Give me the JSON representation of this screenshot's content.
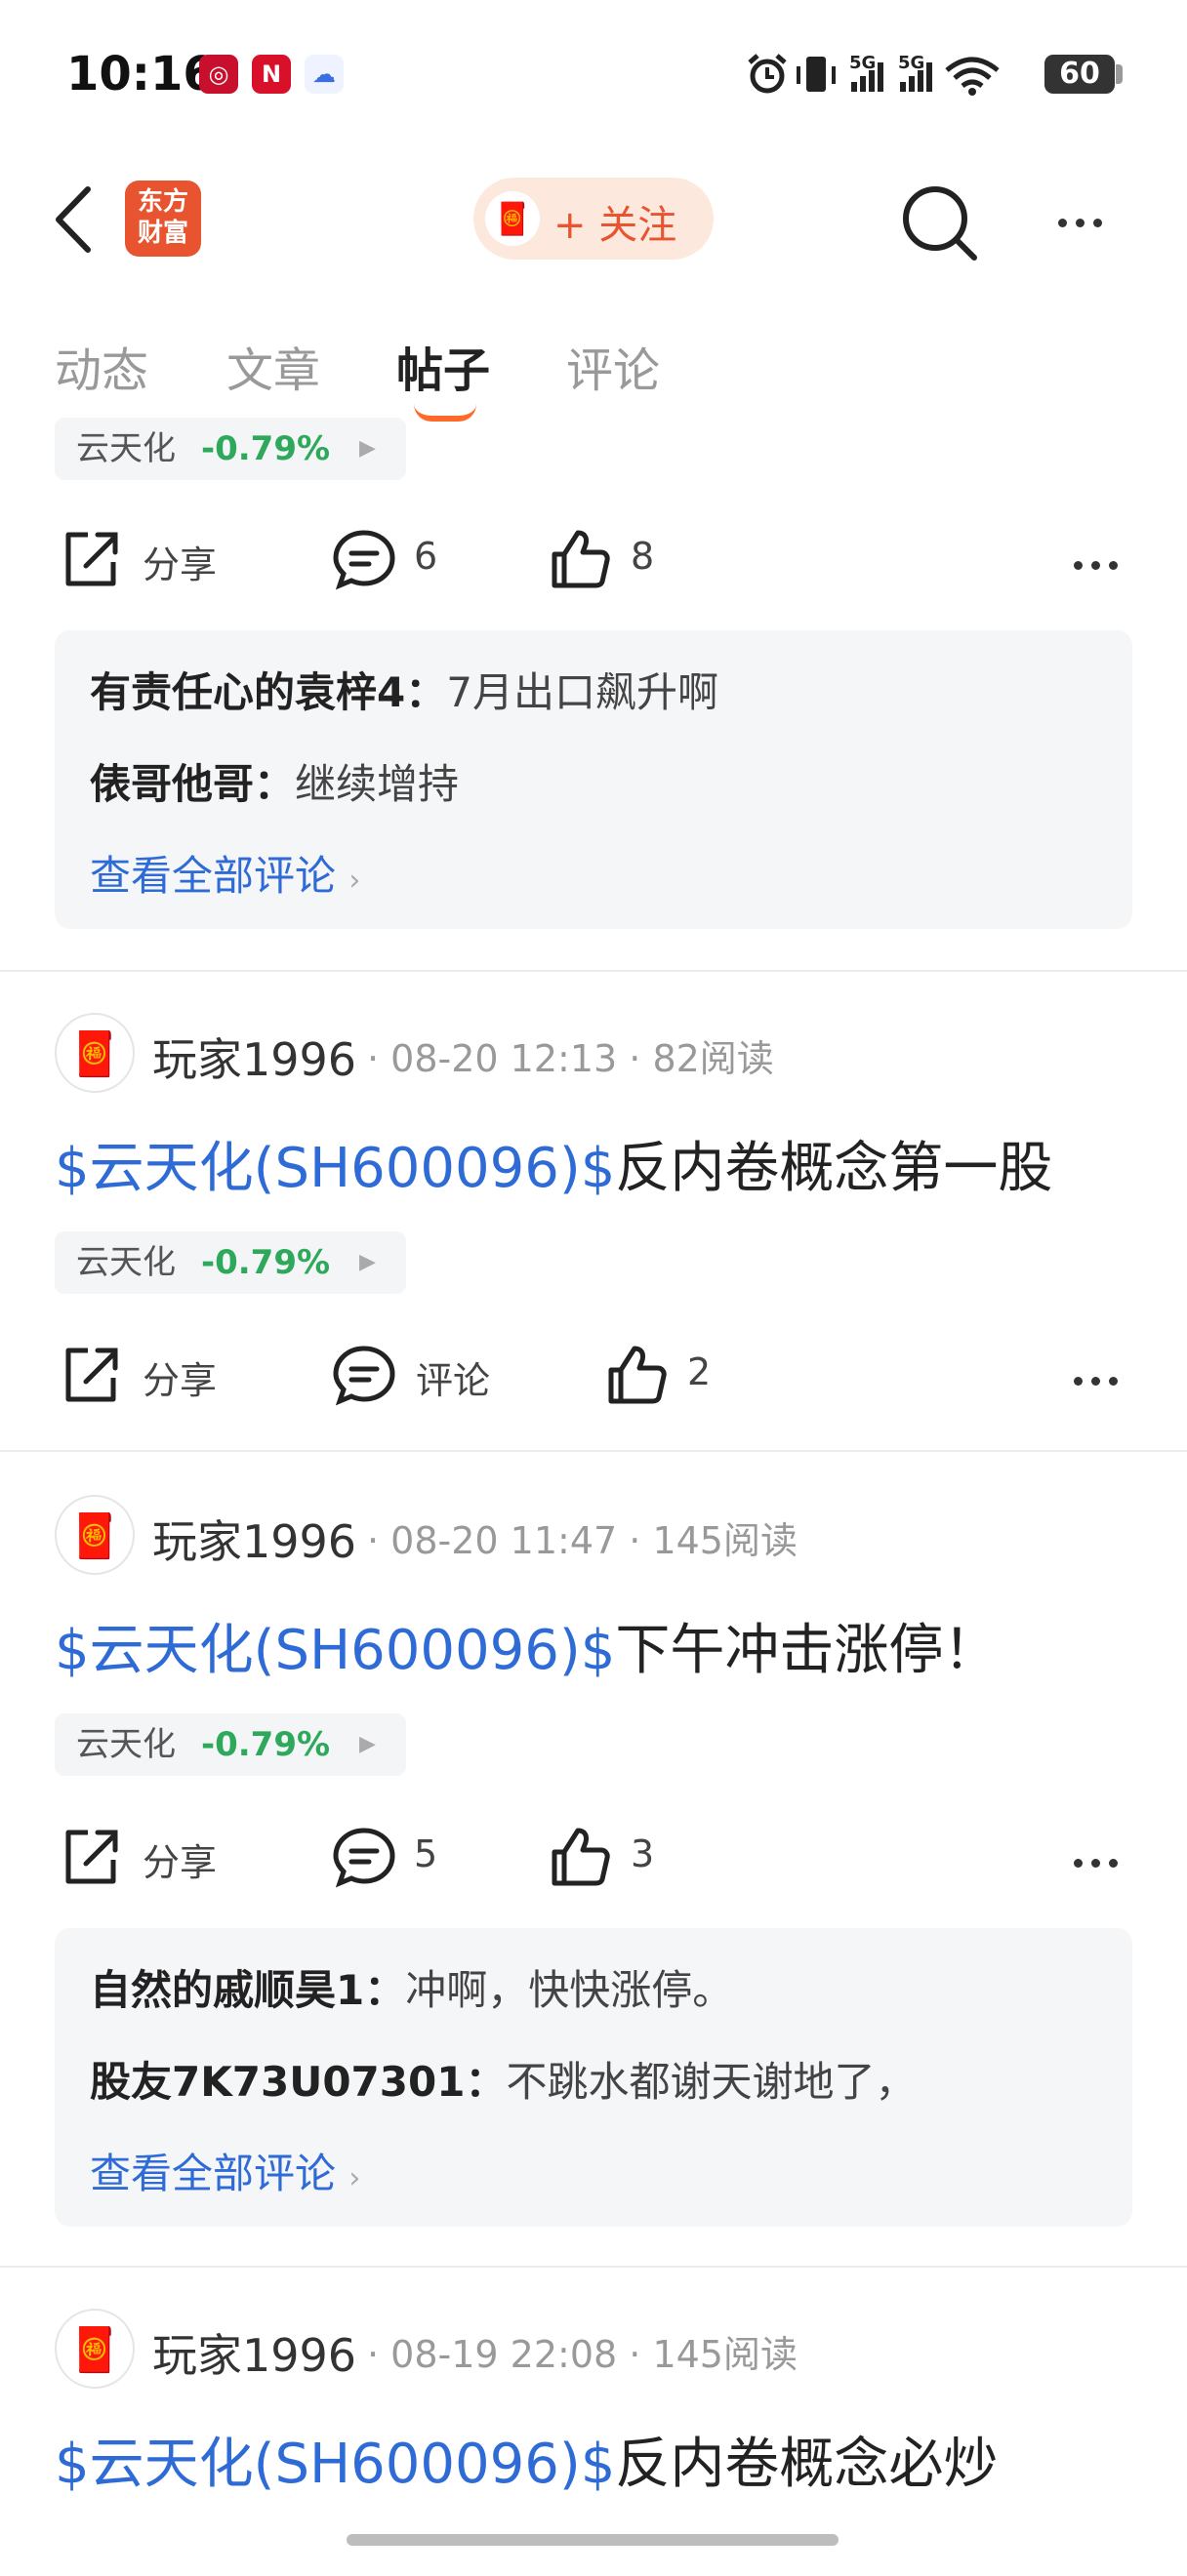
{
  "status_bar": {
    "time": "10:16",
    "battery": "60",
    "network": "5G"
  },
  "header": {
    "logo_text": "东方财富",
    "follow_label": "+ 关注"
  },
  "tabs": [
    {
      "label": "动态"
    },
    {
      "label": "文章"
    },
    {
      "label": "帖子",
      "active": true
    },
    {
      "label": "评论"
    }
  ],
  "post0": {
    "stock": {
      "name": "云天化",
      "change": "-0.79%"
    },
    "share_label": "分享",
    "comment_count": "6",
    "like_count": "8",
    "comments": [
      {
        "user": "有责任心的袁梓4：",
        "text": "7月出口飙升啊"
      },
      {
        "user": "俵哥他哥：",
        "text": "继续增持"
      }
    ],
    "view_all": "查看全部评论"
  },
  "post1": {
    "user": "玩家1996",
    "time": "08-20 12:13",
    "reads": "82阅读",
    "tag": "$云天化(SH600096)$",
    "title_text": "反内卷概念第一股",
    "stock": {
      "name": "云天化",
      "change": "-0.79%"
    },
    "share_label": "分享",
    "comment_label": "评论",
    "like_count": "2"
  },
  "post2": {
    "user": "玩家1996",
    "time": "08-20 11:47",
    "reads": "145阅读",
    "tag": "$云天化(SH600096)$",
    "title_text": "下午冲击涨停！",
    "stock": {
      "name": "云天化",
      "change": "-0.79%"
    },
    "share_label": "分享",
    "comment_count": "5",
    "like_count": "3",
    "comments": [
      {
        "user": "自然的戚顺昊1：",
        "text": "冲啊，快快涨停。"
      },
      {
        "user": "股友7K73U07301：",
        "text": "不跳水都谢天谢地了，"
      }
    ],
    "view_all": "查看全部评论"
  },
  "post3": {
    "user": "玩家1996",
    "time": "08-19 22:08",
    "reads": "145阅读",
    "tag": "$云天化(SH600096)$",
    "title_text": "反内卷概念必炒"
  },
  "colors": {
    "accent": "#e8542f",
    "link": "#2f6bd6",
    "down": "#2ea85a"
  }
}
